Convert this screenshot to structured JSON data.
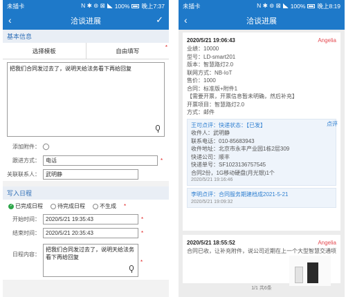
{
  "left": {
    "status": {
      "carrier": "未插卡",
      "indicators": "N ✱ ⊚ ⊠",
      "battery": "100%",
      "time": "晚上7:37"
    },
    "nav": {
      "title": "洽谈进展",
      "back_icon": "chevron-left-icon",
      "confirm_icon": "check-icon"
    },
    "basic_section": "基本信息",
    "tabs": [
      "选择模板",
      "自由填写"
    ],
    "required_mark": "*",
    "note_text": "把我们合同发过去了，说明天给法务看下再给回复",
    "attach_label": "添加附件：",
    "follow_label": "跟进方式：",
    "follow_value": "电话",
    "contact_label": "关联联系人：",
    "contact_value": "武明静",
    "schedule_section": "写入日程",
    "status_options": [
      "已完成日程",
      "待完成日程",
      "不生成"
    ],
    "start_label": "开始时间：",
    "start_value": "2020/5/21 19:35:43",
    "end_label": "结束时间：",
    "end_value": "2020/5/21 20:35:43",
    "content_label": "日程内容：",
    "content_value": "把我们合同发过去了，说明天给法务看下再给回复"
  },
  "right": {
    "status": {
      "carrier": "未插卡",
      "indicators": "N ✱ ⊚ ⊠",
      "battery": "100%",
      "time": "晚上8:19"
    },
    "nav": {
      "title": "洽谈进展"
    },
    "card1": {
      "date": "2020/5/21 19:06:43",
      "author": "Angelia",
      "lines": [
        "业绩：10000",
        "型号：LD-smart201",
        "版本：智慧路灯2.0",
        "联网方式：NB-IoT",
        "售价：1000",
        "合同：标准版+附件1",
        "【需要开票，开票信息暂未明确，然后补充】",
        "开票项目：智慧路灯2.0",
        "方式：邮件"
      ],
      "comment_label": "点评",
      "sub1": {
        "title": "王可点评：快递状态：【已发】",
        "lines": [
          "收件人：武明静",
          "联系电话：010-85683943",
          "收件地址：北京市永丰产业园1栋2层309",
          "快递公司：顺丰",
          "快递单号：SF1023136757545",
          "合同2份，1G移动硬盘(月光银)1个"
        ],
        "time": "2020/5/21 19:16:46"
      },
      "sub2": {
        "title": "李明点评：合同服务期建档成2021-5-21",
        "time": "2020/5/21 19:09:32"
      }
    },
    "card2": {
      "date": "2020/5/21 18:55:52",
      "author": "Angelia",
      "line": "合同已收，让补充附件，说公司近期在上一个大型智慧交通项目，从同"
    },
    "pager": "1/1 共6条"
  }
}
